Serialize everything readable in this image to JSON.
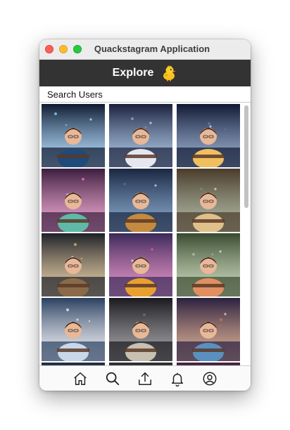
{
  "window": {
    "title": "Quackstagram Application"
  },
  "header": {
    "title": "Explore",
    "icon": "duck-icon"
  },
  "search": {
    "placeholder": "Search Users"
  },
  "grid": {
    "tiles": [
      {
        "icon": "image-thumbnail",
        "palette": [
          "#0e1a2e",
          "#1f4a7a",
          "#88c8ff"
        ]
      },
      {
        "icon": "image-thumbnail",
        "palette": [
          "#1a1f3a",
          "#e6e6ef",
          "#7aa6d6"
        ]
      },
      {
        "icon": "image-thumbnail",
        "palette": [
          "#101832",
          "#f0c060",
          "#5a7ab0"
        ]
      },
      {
        "icon": "image-thumbnail",
        "palette": [
          "#3a1e3e",
          "#5fb8a8",
          "#e070b0"
        ]
      },
      {
        "icon": "image-thumbnail",
        "palette": [
          "#1a2640",
          "#c48a40",
          "#3c6ea8"
        ]
      },
      {
        "icon": "image-thumbnail",
        "palette": [
          "#4a3a2a",
          "#e0c08a",
          "#7a8a6a"
        ]
      },
      {
        "icon": "image-thumbnail",
        "palette": [
          "#1c2028",
          "#8a6a48",
          "#d8b070"
        ]
      },
      {
        "icon": "image-thumbnail",
        "palette": [
          "#3a2a5a",
          "#e8a030",
          "#d050a0"
        ]
      },
      {
        "icon": "image-thumbnail",
        "palette": [
          "#3a4a30",
          "#e09060",
          "#a8c090"
        ]
      },
      {
        "icon": "image-thumbnail",
        "palette": [
          "#2a4060",
          "#c8d8ea",
          "#e8e8f0"
        ]
      },
      {
        "icon": "image-thumbnail",
        "palette": [
          "#1a1a1e",
          "#c8c0b0",
          "#6a6a70"
        ]
      },
      {
        "icon": "image-thumbnail",
        "palette": [
          "#2a2040",
          "#5a90c0",
          "#c07a50"
        ]
      },
      {
        "icon": "image-thumbnail",
        "palette": [
          "#202a40",
          "#6a7aa0",
          "#b0b8d0"
        ]
      },
      {
        "icon": "image-thumbnail",
        "palette": [
          "#2a2a2e",
          "#8a8a90",
          "#d0d0d8"
        ]
      },
      {
        "icon": "image-thumbnail",
        "palette": [
          "#402040",
          "#a070c0",
          "#e0a0d0"
        ]
      }
    ]
  },
  "navbar": {
    "items": [
      {
        "icon": "home-icon"
      },
      {
        "icon": "search-icon"
      },
      {
        "icon": "upload-icon"
      },
      {
        "icon": "bell-icon"
      },
      {
        "icon": "profile-icon"
      }
    ]
  }
}
